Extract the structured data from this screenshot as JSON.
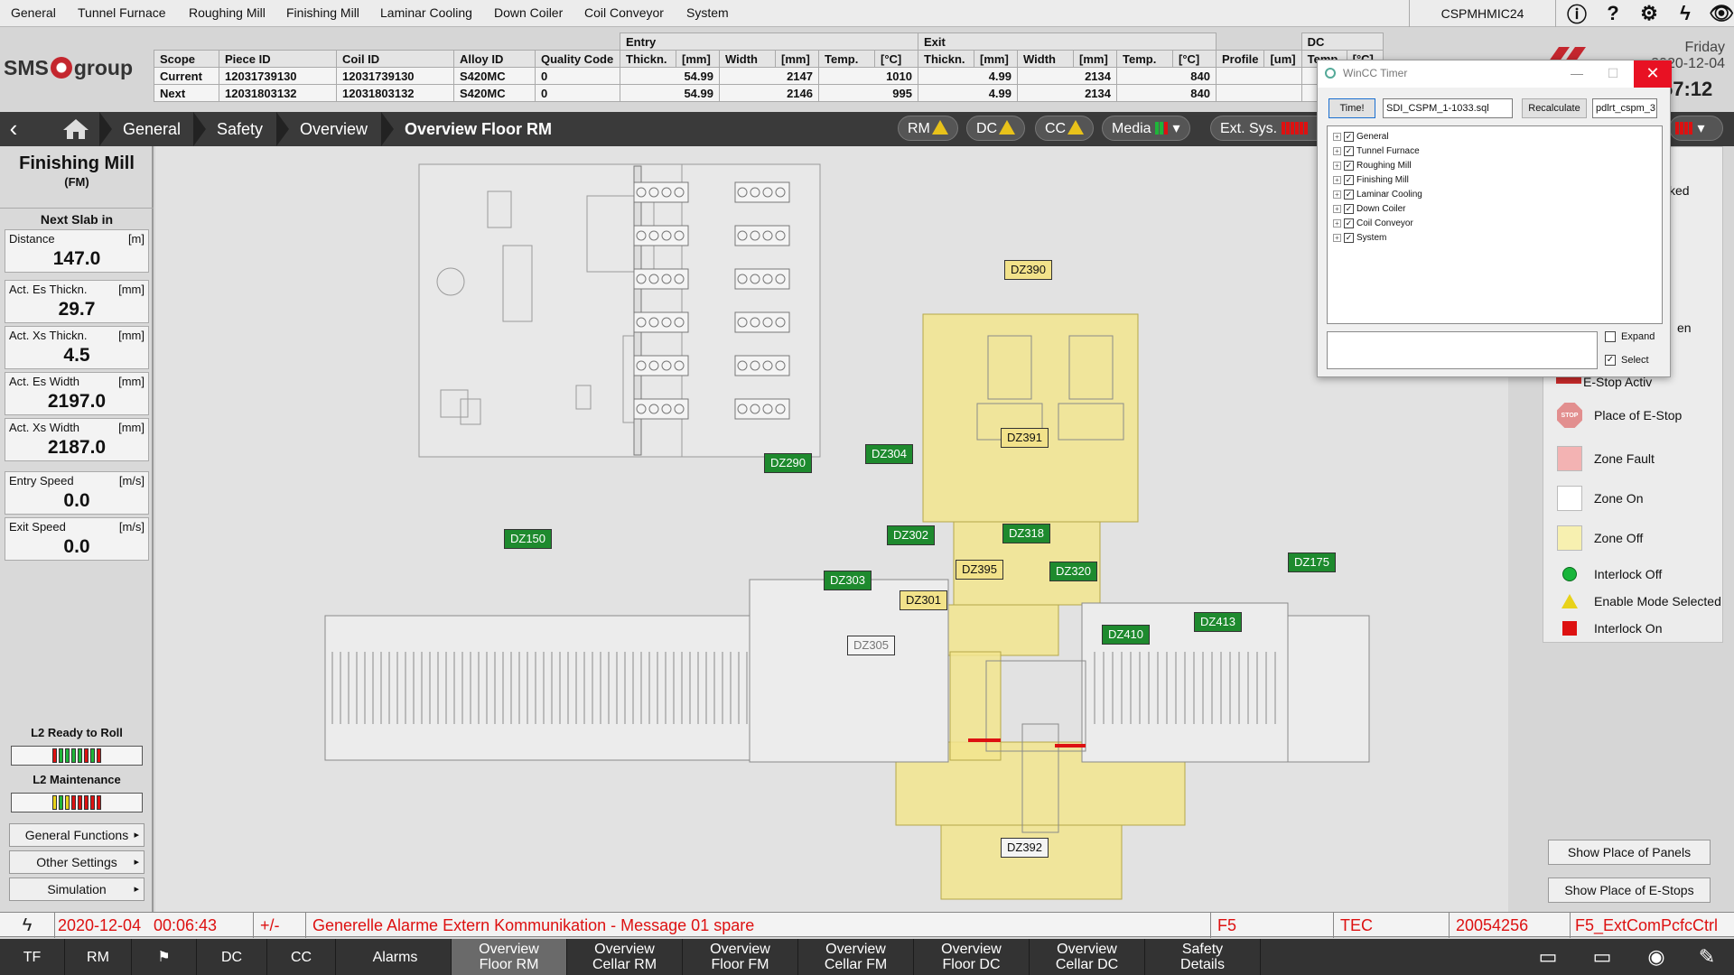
{
  "menu": {
    "items": [
      "General",
      "Tunnel Furnace",
      "Roughing Mill",
      "Finishing Mill",
      "Laminar Cooling",
      "Down Coiler",
      "Coil Conveyor",
      "System"
    ],
    "station": "CSPMHMIC24"
  },
  "logo": {
    "text_left": "SMS",
    "text_right": "group"
  },
  "header_table": {
    "group_entry": "Entry",
    "group_exit": "Exit",
    "group_dc": "DC",
    "columns": [
      "Scope",
      "Piece ID",
      "Coil ID",
      "Alloy ID",
      "Quality Code",
      "Thickn.",
      "[mm]",
      "Width",
      "[mm]",
      "Temp.",
      "[°C]",
      "Thickn.",
      "[mm]",
      "Width",
      "[mm]",
      "Temp.",
      "[°C]",
      "Profile",
      "[um]",
      "Temp",
      "[°C]"
    ],
    "rows": [
      [
        "Current",
        "12031739130",
        "12031739130",
        "S420MC",
        "0",
        "54.99",
        "2147",
        "1010",
        "4.99",
        "2134",
        "840"
      ],
      [
        "Next",
        "12031803132",
        "12031803132",
        "S420MC",
        "0",
        "54.99",
        "2146",
        "995",
        "4.99",
        "2134",
        "840"
      ]
    ]
  },
  "date": {
    "day": "Friday",
    "date": "2020-12-04",
    "time": "57:12"
  },
  "nav": {
    "breadcrumbs": [
      "General",
      "Safety",
      "Overview",
      "Overview  Floor RM"
    ],
    "pills": [
      {
        "label": "RM",
        "warn": true
      },
      {
        "label": "DC",
        "warn": true
      },
      {
        "label": "CC",
        "warn": true
      },
      {
        "label": "Media",
        "leds": [
          "#1fb53a",
          "#1fb53a",
          "#d11"
        ]
      },
      {
        "label": "Ext. Sys.",
        "leds": [
          "#d11",
          "#d11",
          "#d11",
          "#d11",
          "#d11",
          "#d11"
        ]
      }
    ]
  },
  "left_panel": {
    "title": "Finishing Mill",
    "subtitle": "(FM)",
    "next_slab": "Next Slab in",
    "values": [
      {
        "label": "Distance",
        "unit": "[m]",
        "value": "147.0"
      },
      {
        "label": "Act. Es Thickn.",
        "unit": "[mm]",
        "value": "29.7"
      },
      {
        "label": "Act. Xs Thickn.",
        "unit": "[mm]",
        "value": "4.5"
      },
      {
        "label": "Act. Es Width",
        "unit": "[mm]",
        "value": "2197.0"
      },
      {
        "label": "Act. Xs Width",
        "unit": "[mm]",
        "value": "2187.0"
      },
      {
        "label": "Entry Speed",
        "unit": "[m/s]",
        "value": "0.0"
      },
      {
        "label": "Exit Speed",
        "unit": "[m/s]",
        "value": "0.0"
      }
    ],
    "ready_label": "L2 Ready to Roll",
    "ready_leds": [
      "#d11",
      "#1fb53a",
      "#1fb53a",
      "#1fb53a",
      "#1fb53a",
      "#d11",
      "#1fb53a",
      "#d11"
    ],
    "maint_label": "L2 Maintenance",
    "maint_leds": [
      "#e8d21a",
      "#1fb53a",
      "#e8d21a",
      "#d11",
      "#d11",
      "#d11",
      "#d11",
      "#d11"
    ],
    "buttons": [
      "General Functions",
      "Other Settings",
      "Simulation"
    ]
  },
  "zones": [
    "DZ390",
    "DZ391",
    "DZ304",
    "DZ290",
    "DZ301",
    "DZ150",
    "DZ302",
    "DZ318",
    "DZ303",
    "DZ395",
    "DZ320",
    "DZ175",
    "DZ410",
    "DZ413",
    "DZ305",
    "DZ392"
  ],
  "legend": {
    "partial": [
      "cked",
      "en",
      "E-Stop Activ"
    ],
    "items": [
      "Place of E-Stop",
      "Zone Fault",
      "Zone On",
      "Zone Off",
      "Interlock Off",
      "Enable Mode Selected",
      "Interlock On"
    ],
    "buttons": [
      "Show Place of Panels",
      "Show Place of E-Stops"
    ]
  },
  "dialog": {
    "title": "WinCC Timer",
    "time_btn": "Time!",
    "file": "SDI_CSPM_1-1033.sql",
    "recalc_btn": "Recalculate",
    "db": "pdlrt_cspm_3",
    "tree": [
      "General",
      "Tunnel Furnace",
      "Roughing Mill",
      "Finishing Mill",
      "Laminar Cooling",
      "Down Coiler",
      "Coil Conveyor",
      "System"
    ],
    "expand": "Expand",
    "select": "Select",
    "min": "—",
    "max": "☐",
    "close": "✕"
  },
  "alarm": {
    "date": "2020-12-04",
    "time": "00:06:43",
    "sign": "+/-",
    "message": "Generelle Alarme Extern Kommunikation - Message 01 spare",
    "code": "F5",
    "type": "TEC",
    "number": "20054256",
    "tag": "F5_ExtComPcfcCtrl"
  },
  "bottom": {
    "buttons": [
      "TF",
      "RM",
      "",
      "DC",
      "CC",
      "Alarms"
    ],
    "views": [
      "Overview\nFloor RM",
      "Overview\nCellar RM",
      "Overview\nFloor FM",
      "Overview\nCellar FM",
      "Overview\nFloor DC",
      "Overview\nCellar DC",
      "Safety\nDetails"
    ]
  },
  "colors": {
    "zone_on": "#1e8a2e",
    "zone_off": "#f2e28a",
    "zone_fault": "#f3b3b3",
    "nav": "#3a3a3a",
    "alarm_text": "#d11111"
  }
}
